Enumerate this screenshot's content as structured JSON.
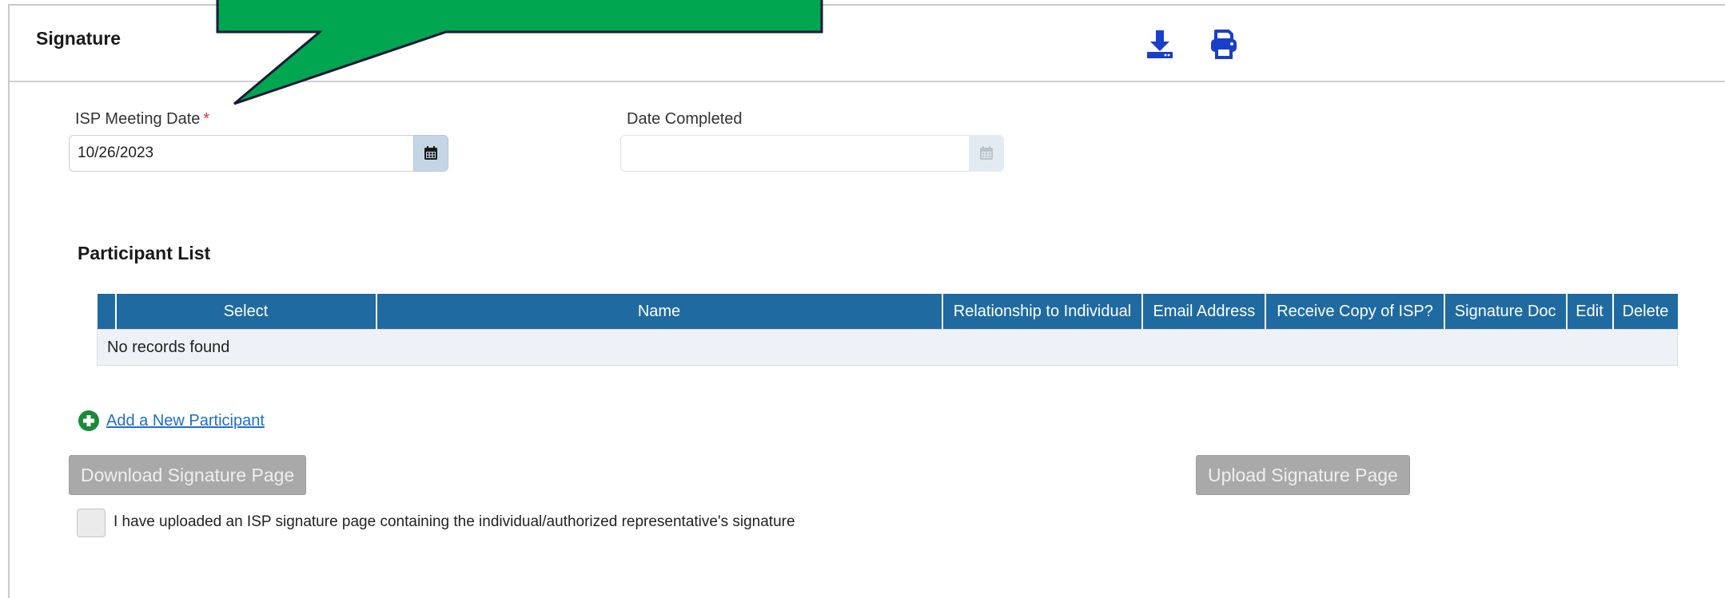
{
  "panel": {
    "title": "Signature",
    "icons": {
      "download": "download-icon",
      "print": "print-icon"
    },
    "accent_color": "#1f6aa1",
    "icon_color": "#1a3fc9"
  },
  "form": {
    "isp_meeting_date": {
      "label": "ISP Meeting Date",
      "required_mark": "*",
      "value": "10/26/2023"
    },
    "date_completed": {
      "label": "Date Completed",
      "value": ""
    }
  },
  "participants": {
    "title": "Participant List",
    "columns": [
      "Select",
      "Name",
      "Relationship to Individual",
      "Email Address",
      "Receive Copy of ISP?",
      "Signature Doc",
      "Edit",
      "Delete"
    ],
    "empty_message": "No records found"
  },
  "actions": {
    "add_participant": "Add a New Participant",
    "download_signature": "Download Signature Page",
    "upload_signature": "Upload Signature Page"
  },
  "attestation": {
    "label": "I have uploaded an ISP signature page containing the individual/authorized representative's signature",
    "checked": false
  },
  "callout": {
    "color": "#00a650"
  }
}
